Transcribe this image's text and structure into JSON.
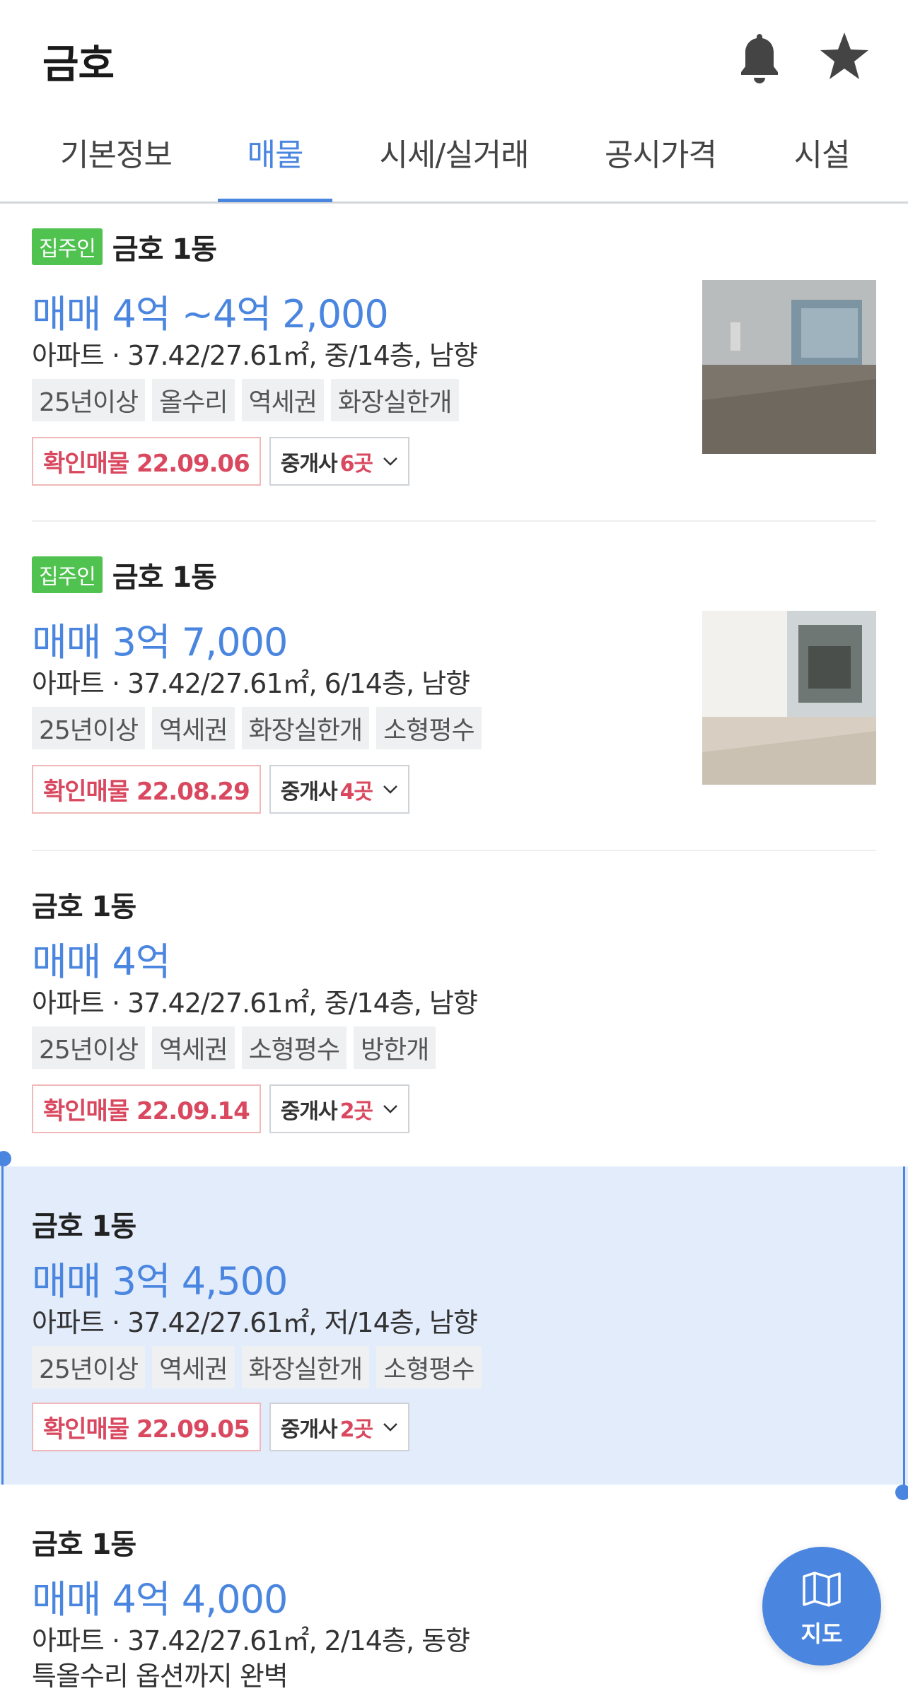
{
  "header": {
    "title": "금호"
  },
  "tabs": [
    {
      "label": "기본정보",
      "active": false
    },
    {
      "label": "매물",
      "active": true
    },
    {
      "label": "시세/실거래",
      "active": false
    },
    {
      "label": "공시가격",
      "active": false
    },
    {
      "label": "시설",
      "active": false
    }
  ],
  "listings": [
    {
      "owner_badge": "집주인",
      "building": "금호 1동",
      "price": "매매 4억 ~4억 2,000",
      "spec": "아파트 · 37.42/27.61㎡, 중/14층, 남향",
      "tags": [
        "25년이상",
        "올수리",
        "역세권",
        "화장실한개"
      ],
      "confirm_label": "확인매물",
      "confirm_date": "22.09.06",
      "agent_label": "중개사",
      "agent_count": "6곳",
      "has_photo": true
    },
    {
      "owner_badge": "집주인",
      "building": "금호 1동",
      "price": "매매 3억 7,000",
      "spec": "아파트 · 37.42/27.61㎡, 6/14층, 남향",
      "tags": [
        "25년이상",
        "역세권",
        "화장실한개",
        "소형평수"
      ],
      "confirm_label": "확인매물",
      "confirm_date": "22.08.29",
      "agent_label": "중개사",
      "agent_count": "4곳",
      "has_photo": true
    },
    {
      "owner_badge": "",
      "building": "금호 1동",
      "price": "매매 4억",
      "spec": "아파트 · 37.42/27.61㎡, 중/14층, 남향",
      "tags": [
        "25년이상",
        "역세권",
        "소형평수",
        "방한개"
      ],
      "confirm_label": "확인매물",
      "confirm_date": "22.09.14",
      "agent_label": "중개사",
      "agent_count": "2곳",
      "has_photo": false
    },
    {
      "owner_badge": "",
      "building": "금호 1동",
      "price": "매매 3억 4,500",
      "spec": "아파트 · 37.42/27.61㎡, 저/14층, 남향",
      "tags": [
        "25년이상",
        "역세권",
        "화장실한개",
        "소형평수"
      ],
      "confirm_label": "확인매물",
      "confirm_date": "22.09.05",
      "agent_label": "중개사",
      "agent_count": "2곳",
      "has_photo": false,
      "selected": true
    },
    {
      "owner_badge": "",
      "building": "금호 1동",
      "price": "매매 4억 4,000",
      "spec": "아파트 · 37.42/27.61㎡, 2/14층, 동향",
      "description": "특올수리 옵션까지 완벽",
      "has_photo": false
    }
  ],
  "map_button": {
    "label": "지도"
  },
  "icons": [
    "bell-icon",
    "star-icon",
    "chevron-down-icon",
    "map-icon"
  ],
  "colors": {
    "accent": "#4a86e0",
    "owner_badge": "#4fc24f",
    "confirm": "#d9485f",
    "selected_bg": "#e3ecfb"
  }
}
